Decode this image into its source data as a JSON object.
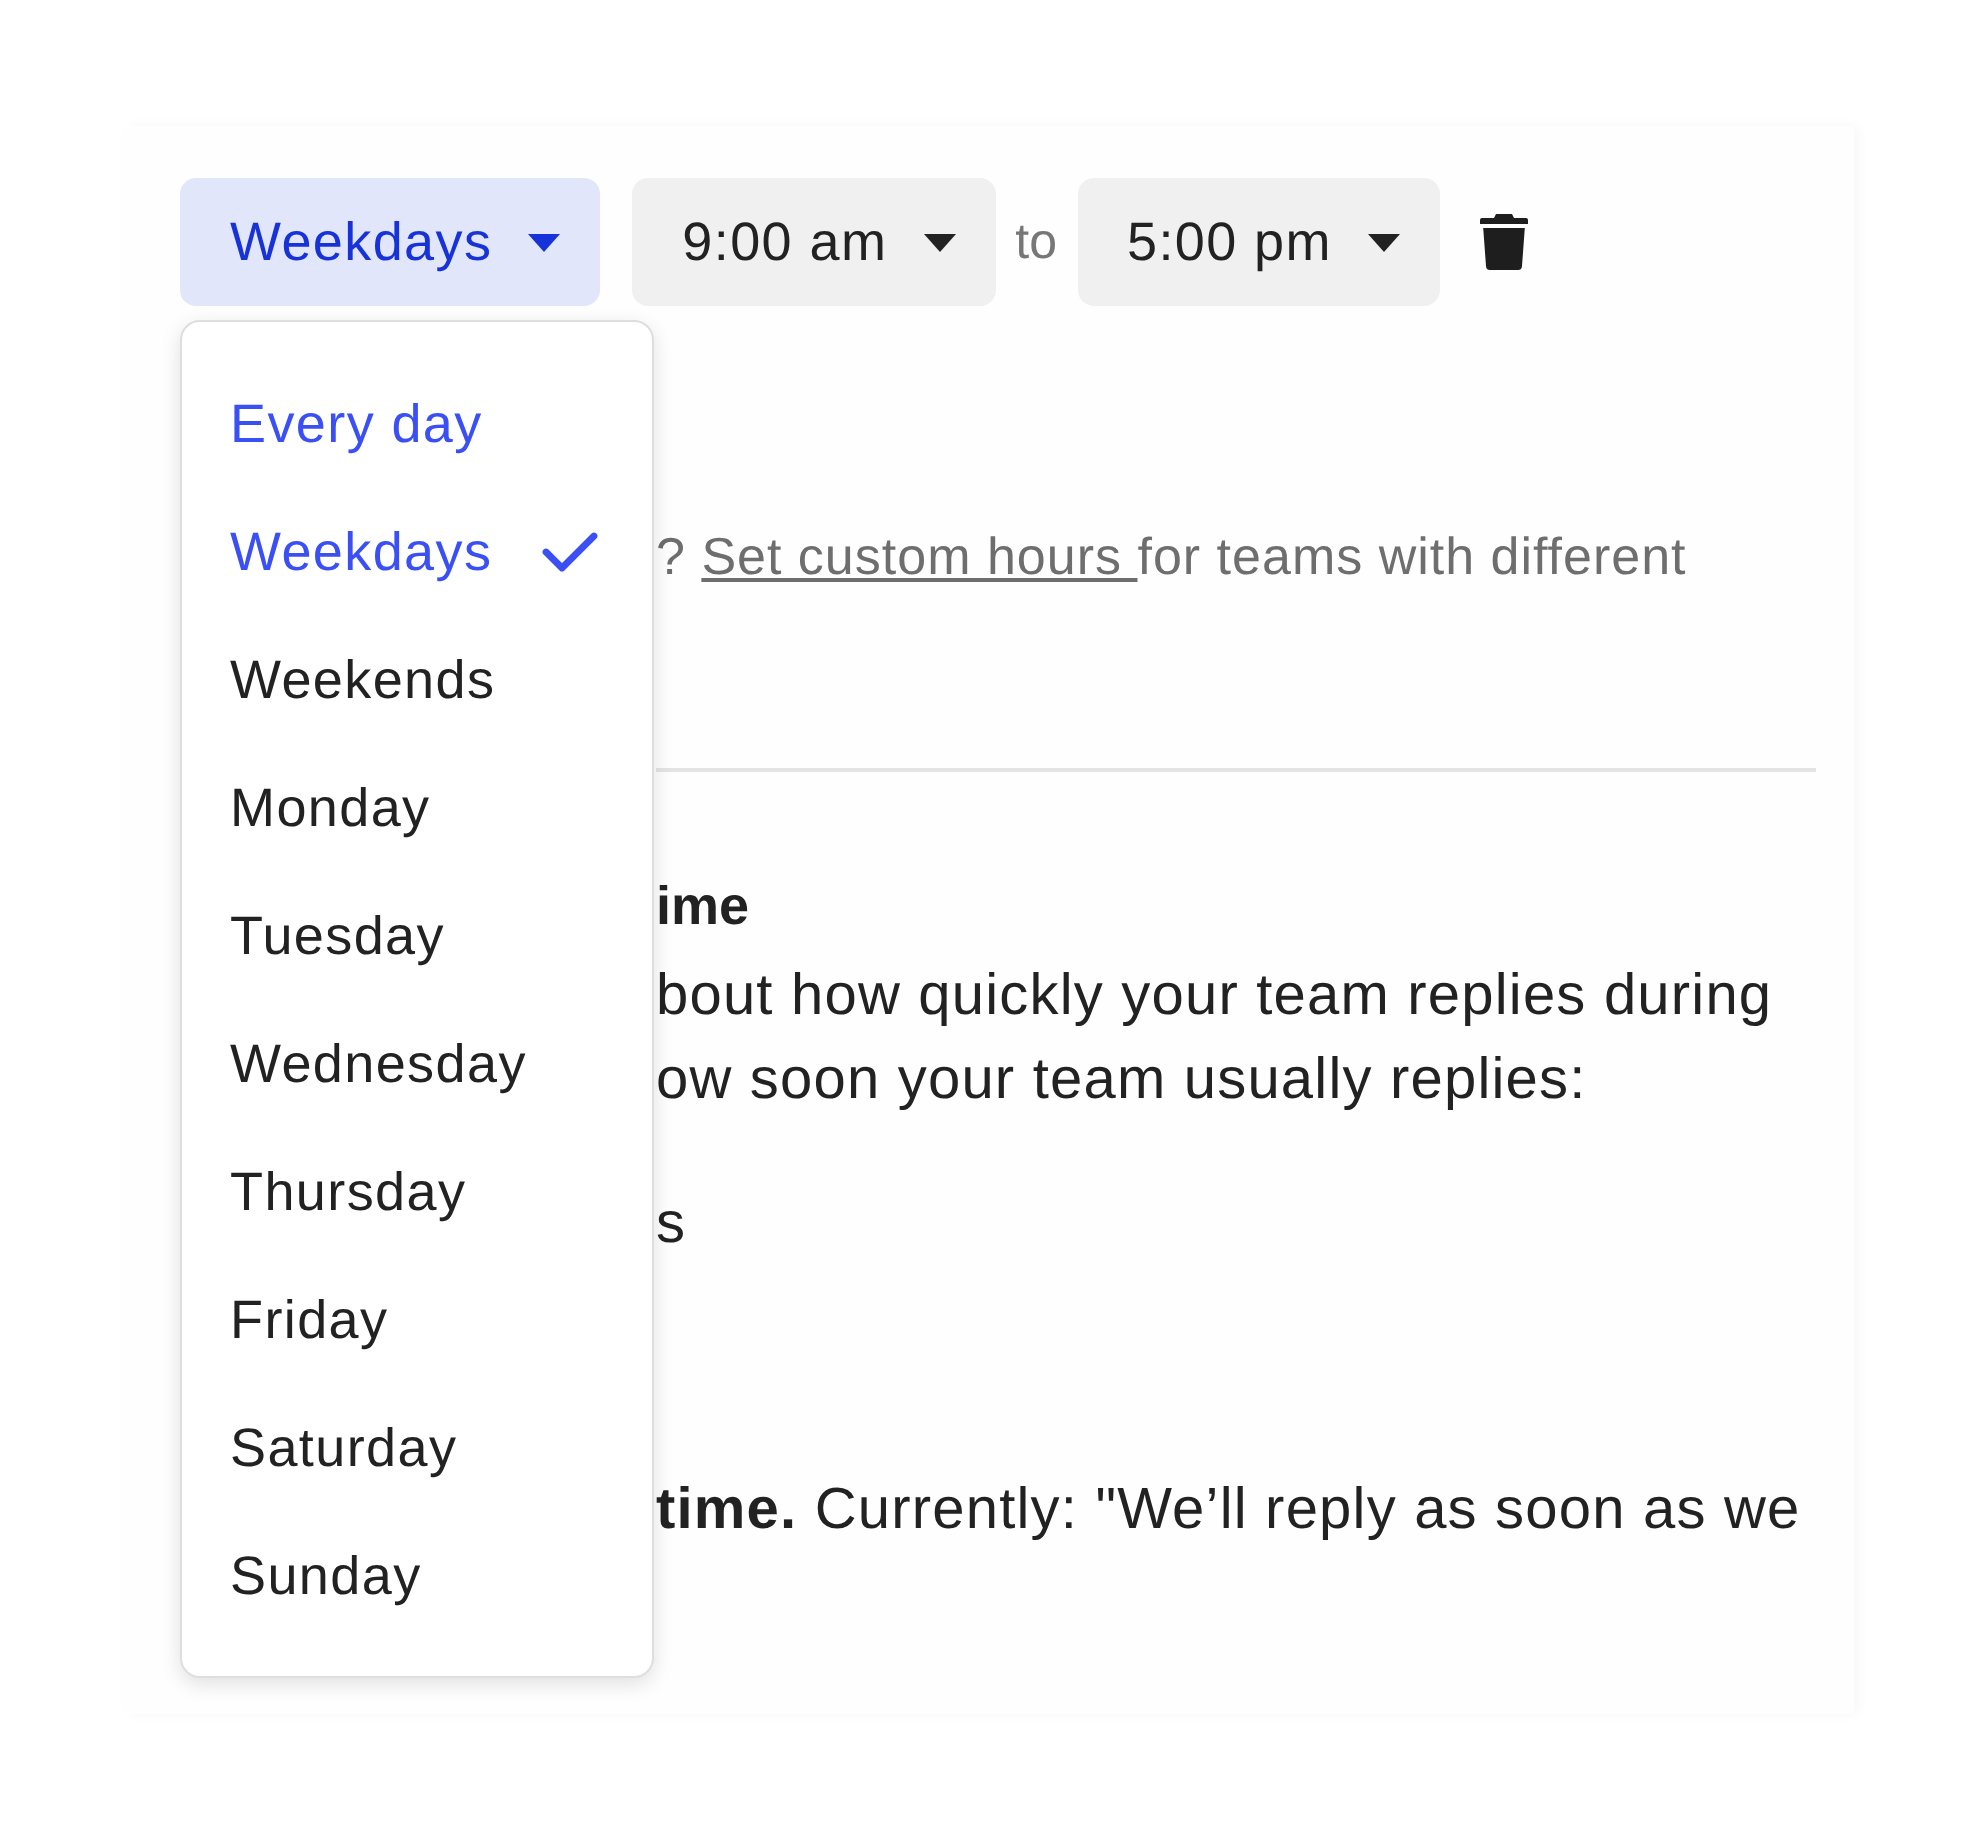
{
  "schedule": {
    "day_select": {
      "value": "Weekdays",
      "expanded": true
    },
    "start_time": {
      "value": "9:00 am"
    },
    "separator": "to",
    "end_time": {
      "value": "5:00 pm"
    }
  },
  "day_menu": {
    "items": [
      {
        "label": "Every day",
        "highlighted": true,
        "selected": false
      },
      {
        "label": "Weekdays",
        "highlighted": true,
        "selected": true
      },
      {
        "label": "Weekends",
        "highlighted": false,
        "selected": false
      },
      {
        "label": "Monday",
        "highlighted": false,
        "selected": false
      },
      {
        "label": "Tuesday",
        "highlighted": false,
        "selected": false
      },
      {
        "label": "Wednesday",
        "highlighted": false,
        "selected": false
      },
      {
        "label": "Thursday",
        "highlighted": false,
        "selected": false
      },
      {
        "label": "Friday",
        "highlighted": false,
        "selected": false
      },
      {
        "label": "Saturday",
        "highlighted": false,
        "selected": false
      },
      {
        "label": "Sunday",
        "highlighted": false,
        "selected": false
      }
    ]
  },
  "background": {
    "custom_hours_note": {
      "prefix": "? ",
      "link": "Set custom hours ",
      "suffix": "for teams with different"
    },
    "heading": "ime",
    "description_lines": [
      "bout how quickly your team replies during",
      "ow soon your team usually replies:"
    ],
    "fragment": "s",
    "reply_time": "**time.** Currently: \"We’ll reply as soon as we"
  }
}
